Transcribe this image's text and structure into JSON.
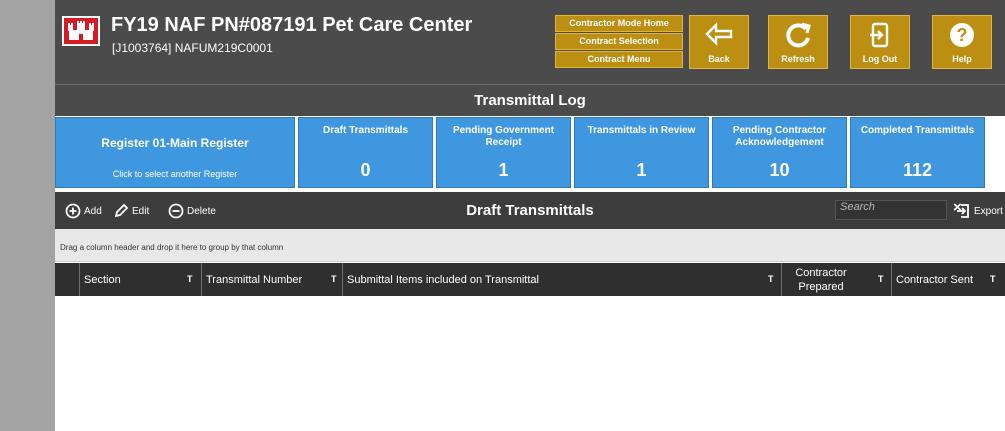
{
  "header": {
    "title": "FY19 NAF PN#087191 Pet Care Center",
    "subtitle": "[J1003764] NAFUM219C0001",
    "mode_menu": [
      "Contractor Mode Home",
      "Contract Selection",
      "Contract Menu"
    ],
    "buttons": {
      "back": "Back",
      "refresh": "Refresh",
      "logout": "Log Out",
      "help": "Help"
    }
  },
  "log_title": "Transmittal Log",
  "register": {
    "name": "Register 01-Main Register",
    "help": "Click to select another Register"
  },
  "status_cards": [
    {
      "title": "Draft Transmittals",
      "value": "0"
    },
    {
      "title": "Pending Government Receipt",
      "value": "1"
    },
    {
      "title": "Transmittals in Review",
      "value": "1"
    },
    {
      "title": "Pending Contractor Acknowledgement",
      "value": "10"
    },
    {
      "title": "Completed Transmittals",
      "value": "112"
    }
  ],
  "toolbar": {
    "add": "Add",
    "edit": "Edit",
    "delete": "Delete",
    "title": "Draft Transmittals",
    "search_placeholder": "Search",
    "clear": "×",
    "export": "Export"
  },
  "grouping_hint": "Drag a column header and drop it here to group by that column",
  "columns": [
    "Section",
    "Transmittal Number",
    "Submittal Items included on Transmittal",
    "Contractor Prepared",
    "Contractor Sent"
  ],
  "filter_icon": "T",
  "colors": {
    "header": "#4b4b4b",
    "accent": "#bc8f12",
    "cards": "#3f97df"
  }
}
